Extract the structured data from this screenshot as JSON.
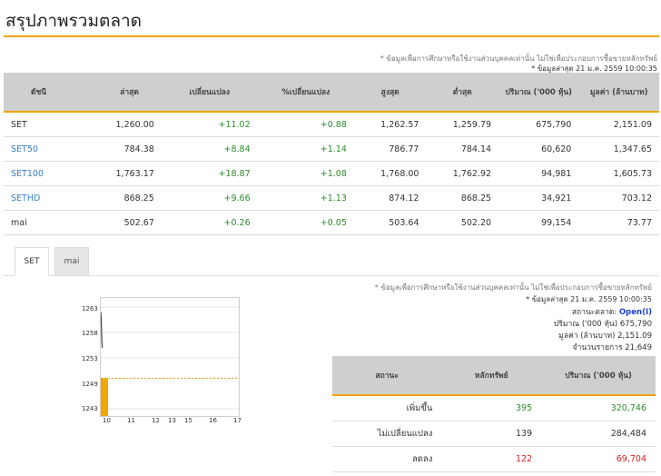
{
  "page": {
    "title": "สรุปภาพรวมตลาด"
  },
  "notes": {
    "disclaimer": "* ข้อมูลเพื่อการศึกษาหรือใช้งานส่วนบุคคลเท่านั้น ไม่ใช่เพื่อประกอบการซื้อขายหลักทรัพย์",
    "updated": "* ข้อมูลล่าสุด 21 ม.ค. 2559 10:00:35"
  },
  "index_table": {
    "headers": [
      "ดัชนี",
      "ล่าสุด",
      "เปลี่ยนแปลง",
      "%เปลี่ยนแปลง",
      "สูงสุด",
      "ต่ำสุด",
      "ปริมาณ ('000 หุ้น)",
      "มูลค่า (ล้านบาท)"
    ],
    "rows": [
      {
        "name": "SET",
        "last": "1,260.00",
        "chg": "+11.02",
        "pct": "+0.88",
        "high": "1,262.57",
        "low": "1,259.79",
        "vol": "675,790",
        "val": "2,151.09"
      },
      {
        "name": "SET50",
        "last": "784.38",
        "chg": "+8.84",
        "pct": "+1.14",
        "high": "786.77",
        "low": "784.14",
        "vol": "60,620",
        "val": "1,347.65"
      },
      {
        "name": "SET100",
        "last": "1,763.17",
        "chg": "+18.87",
        "pct": "+1.08",
        "high": "1,768.00",
        "low": "1,762.92",
        "vol": "94,981",
        "val": "1,605.73"
      },
      {
        "name": "SETHD",
        "last": "868.25",
        "chg": "+9.66",
        "pct": "+1.13",
        "high": "874.12",
        "low": "868.25",
        "vol": "34,921",
        "val": "703.12"
      },
      {
        "name": "mai",
        "last": "502.67",
        "chg": "+0.26",
        "pct": "+0.05",
        "high": "503.64",
        "low": "502.20",
        "vol": "99,154",
        "val": "73.77"
      }
    ]
  },
  "tabs": [
    "SET",
    "mai"
  ],
  "chart_data": {
    "type": "line",
    "x_ticks": [
      "10",
      "11",
      "12",
      "13",
      "15",
      "16",
      "17"
    ],
    "y_ticks": [
      "1263",
      "1258",
      "1253",
      "1249",
      "1243"
    ],
    "ylim": [
      1243,
      1263
    ],
    "reference_line": 1249,
    "series": [
      {
        "x": [
          10.0,
          10.02,
          10.04,
          10.06,
          10.08
        ],
        "y": [
          1262,
          1261,
          1258,
          1256,
          1255
        ]
      }
    ],
    "volume_bar": {
      "x": 10,
      "color": "#f0a500"
    }
  },
  "market_info": {
    "status_label": "สถานะตลาด:",
    "status_value": "Open(I)",
    "volume_label": "ปริมาณ ('000 หุ้น)",
    "volume_value": "675,790",
    "value_label": "มูลค่า (ล้านบาท)",
    "value_value": "2,151.09",
    "trades_label": "จำนวนรายการ",
    "trades_value": "21,649"
  },
  "status_table": {
    "headers": [
      "สถานะ",
      "หลักทรัพย์",
      "ปริมาณ ('000 หุ้น)"
    ],
    "rows": [
      {
        "label": "เพิ่มขึ้น",
        "count": "395",
        "volume": "320,746"
      },
      {
        "label": "ไม่เปลี่ยนแปลง",
        "count": "139",
        "volume": "284,484"
      },
      {
        "label": "ลดลง",
        "count": "122",
        "volume": "69,704"
      }
    ]
  },
  "colors": {
    "accent": "#f0a500",
    "up": "#2e8b2e",
    "down": "#d42020",
    "link": "#3a7dc0",
    "open": "#1a3fd1"
  }
}
